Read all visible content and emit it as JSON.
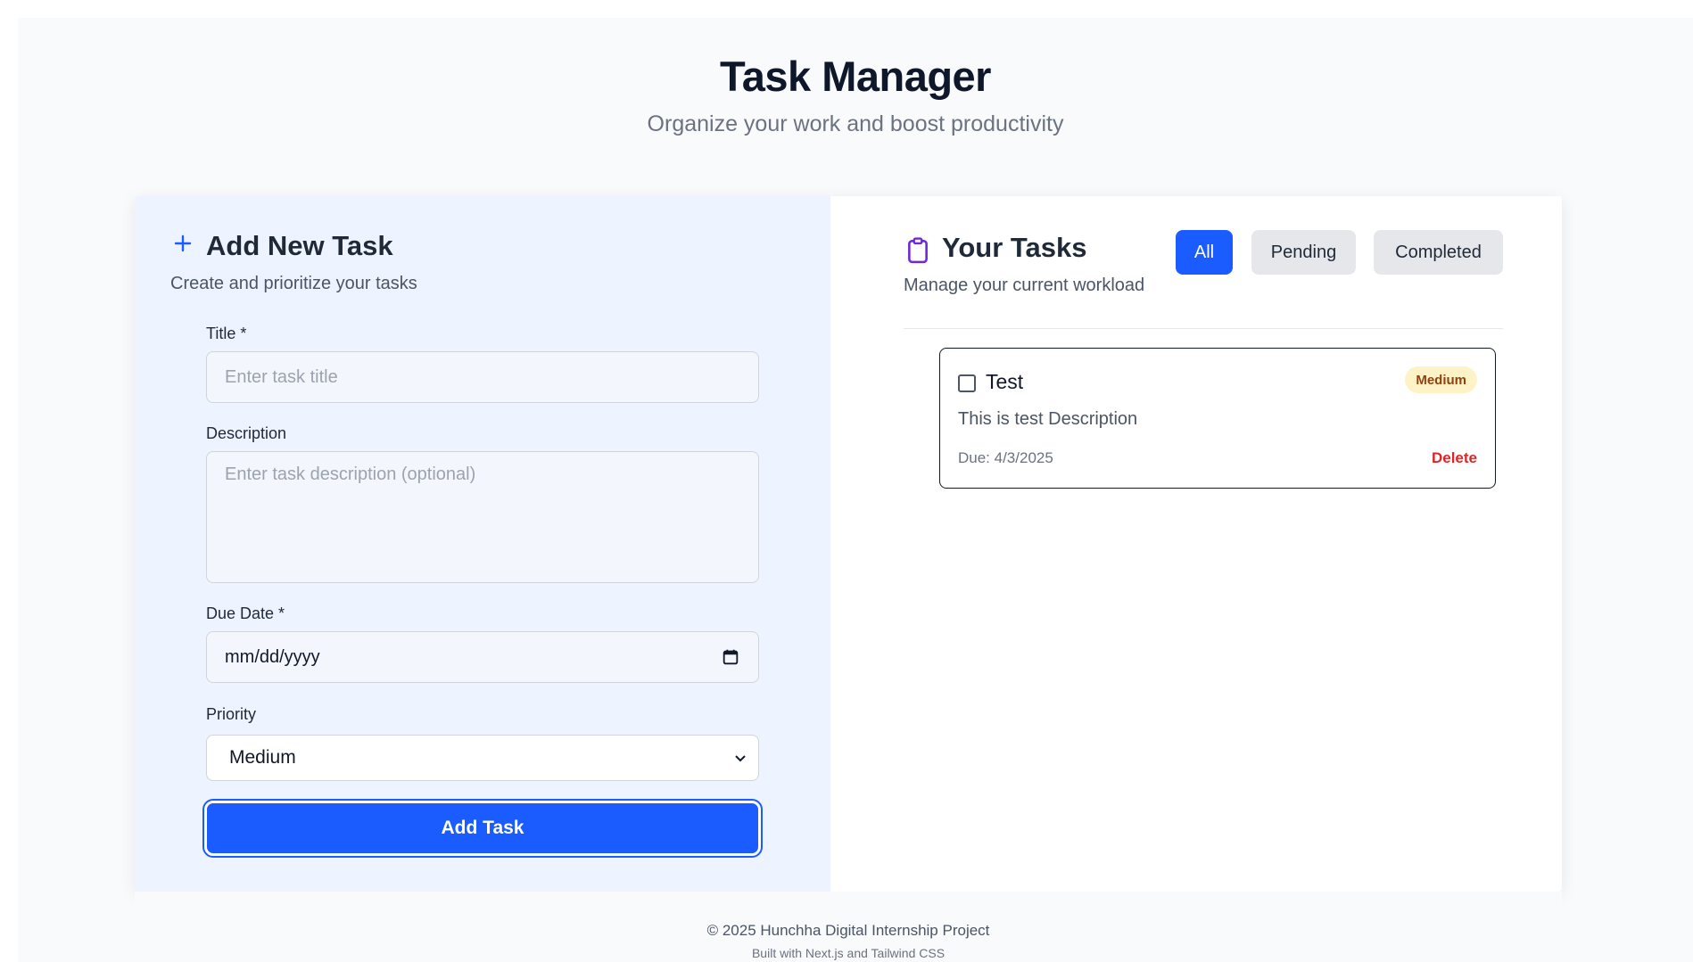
{
  "header": {
    "title": "Task Manager",
    "subtitle": "Organize your work and boost productivity"
  },
  "add_form": {
    "icon": "plus-icon",
    "title": "Add New Task",
    "subtitle": "Create and prioritize your tasks",
    "title_label": "Title *",
    "title_placeholder": "Enter task title",
    "title_value": "",
    "description_label": "Description",
    "description_placeholder": "Enter task description (optional)",
    "description_value": "",
    "due_date_label": "Due Date *",
    "due_date_value": "mm/dd/yyyy",
    "priority_label": "Priority",
    "priority_selected": "Medium",
    "submit_label": "Add Task",
    "accent_color": "#1a5cff"
  },
  "task_list": {
    "icon": "clipboard-icon",
    "title": "Your Tasks",
    "subtitle": "Manage your current workload",
    "filters": [
      {
        "label": "All",
        "active": true
      },
      {
        "label": "Pending",
        "active": false
      },
      {
        "label": "Completed",
        "active": false
      }
    ],
    "tasks": [
      {
        "title": "Test",
        "completed": false,
        "priority": "Medium",
        "priority_color": "#fef3c7",
        "description": "This is test Description",
        "due": "Due: 4/3/2025",
        "delete_label": "Delete"
      }
    ]
  },
  "footer": {
    "copyright": "© 2025 Hunchha Digital Internship Project",
    "built_with": "Built with Next.js and Tailwind CSS"
  }
}
